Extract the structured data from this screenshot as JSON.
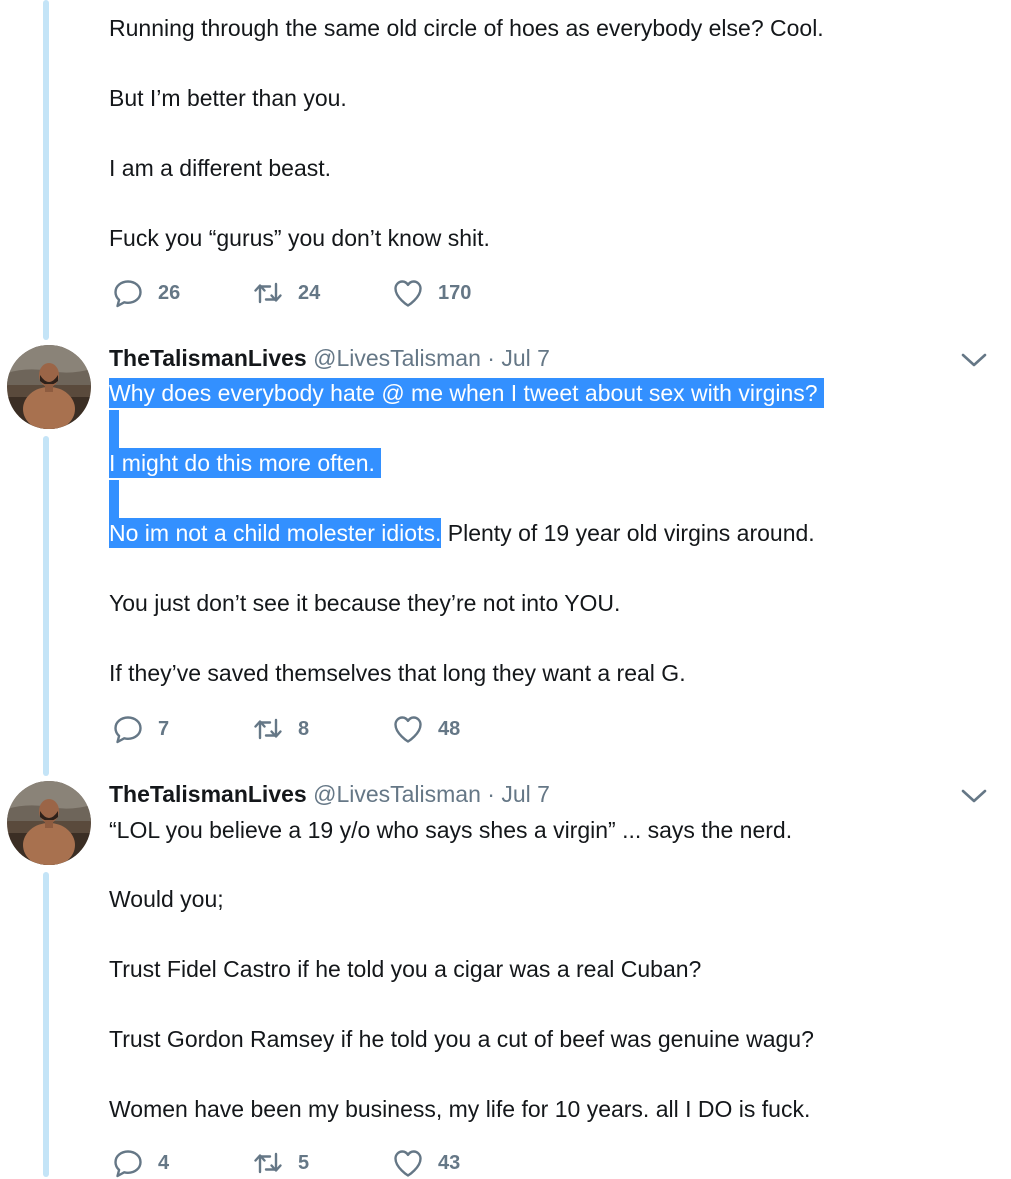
{
  "tweets": [
    {
      "lines": [
        "Running through the same old circle of hoes as everybody else? Cool.",
        "But I’m better than you.",
        "I am a different beast.",
        "Fuck you “gurus” you don’t know shit."
      ],
      "stats": {
        "replies": "26",
        "retweets": "24",
        "likes": "170"
      }
    },
    {
      "author": {
        "name": "TheTalismanLives",
        "handle": "@LivesTalisman",
        "separator": "·",
        "date": "Jul 7"
      },
      "selected": [
        "Why does everybody hate @ me when I tweet about sex with virgins?",
        "I might do this more often.",
        "No im not a child molester idiots."
      ],
      "line3_rest": " Plenty of 19 year old virgins around.",
      "lines": [
        "You just don’t see it because they’re not into YOU.",
        "If they’ve saved themselves that long they want a real G."
      ],
      "stats": {
        "replies": "7",
        "retweets": "8",
        "likes": "48"
      }
    },
    {
      "author": {
        "name": "TheTalismanLives",
        "handle": "@LivesTalisman",
        "separator": "·",
        "date": "Jul 7"
      },
      "lines": [
        "“LOL you believe a 19 y/o who says shes a virgin” ... says the nerd.",
        "Would you;",
        "Trust Fidel Castro if he told you a cigar was a real Cuban?",
        "Trust Gordon Ramsey if he told you a cut of beef was genuine wagu?",
        "Women have been my business, my life for 10 years. all I DO is fuck."
      ],
      "stats": {
        "replies": "4",
        "retweets": "5",
        "likes": "43"
      }
    }
  ],
  "icons": {
    "reply": "speech-bubble",
    "retweet": "retweet-arrows",
    "like": "heart-outline",
    "menu": "chevron-down"
  },
  "colors": {
    "thread_line": "#c4e4f7",
    "action_gray": "#657786",
    "selection": "#3390ff"
  }
}
